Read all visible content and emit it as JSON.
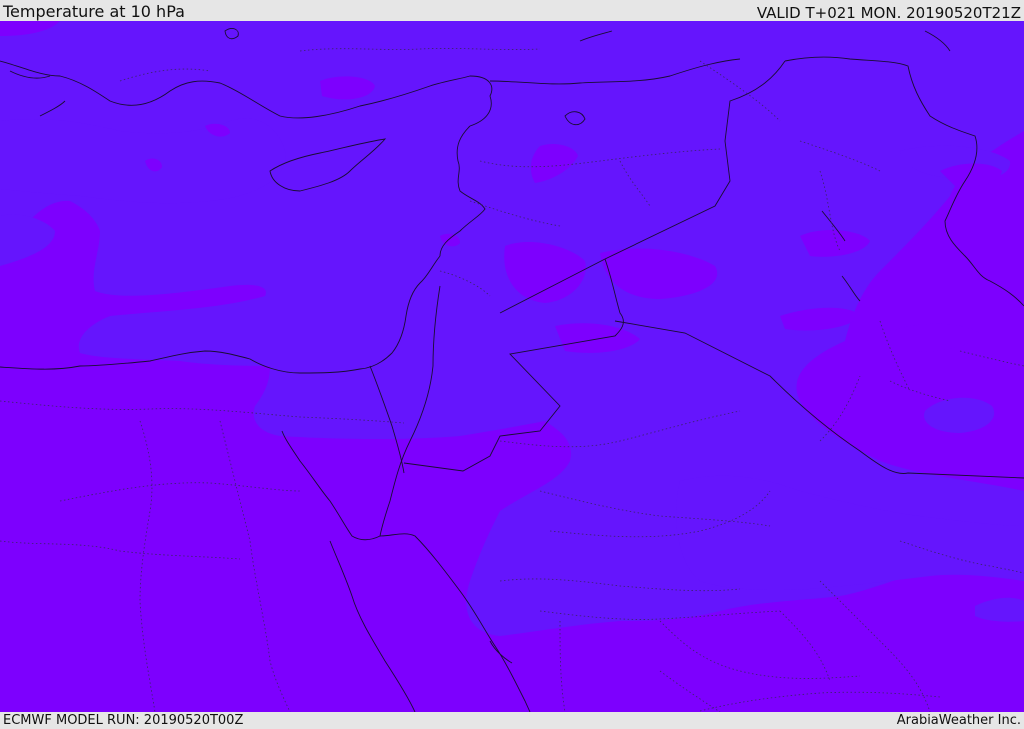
{
  "header": {
    "title": "Temperature at 10 hPa",
    "valid_time": "VALID T+021 MON. 20190520T21Z"
  },
  "footer": {
    "model_run": "ECMWF MODEL RUN: 20190520T00Z",
    "provider": "ArabiaWeather Inc."
  },
  "colors": {
    "field_warm": "#7d00fe",
    "field_cool": "#6515fd",
    "coastline": "#1a0d33",
    "border": "#1a0d33",
    "internal_border": "#3a2466"
  }
}
